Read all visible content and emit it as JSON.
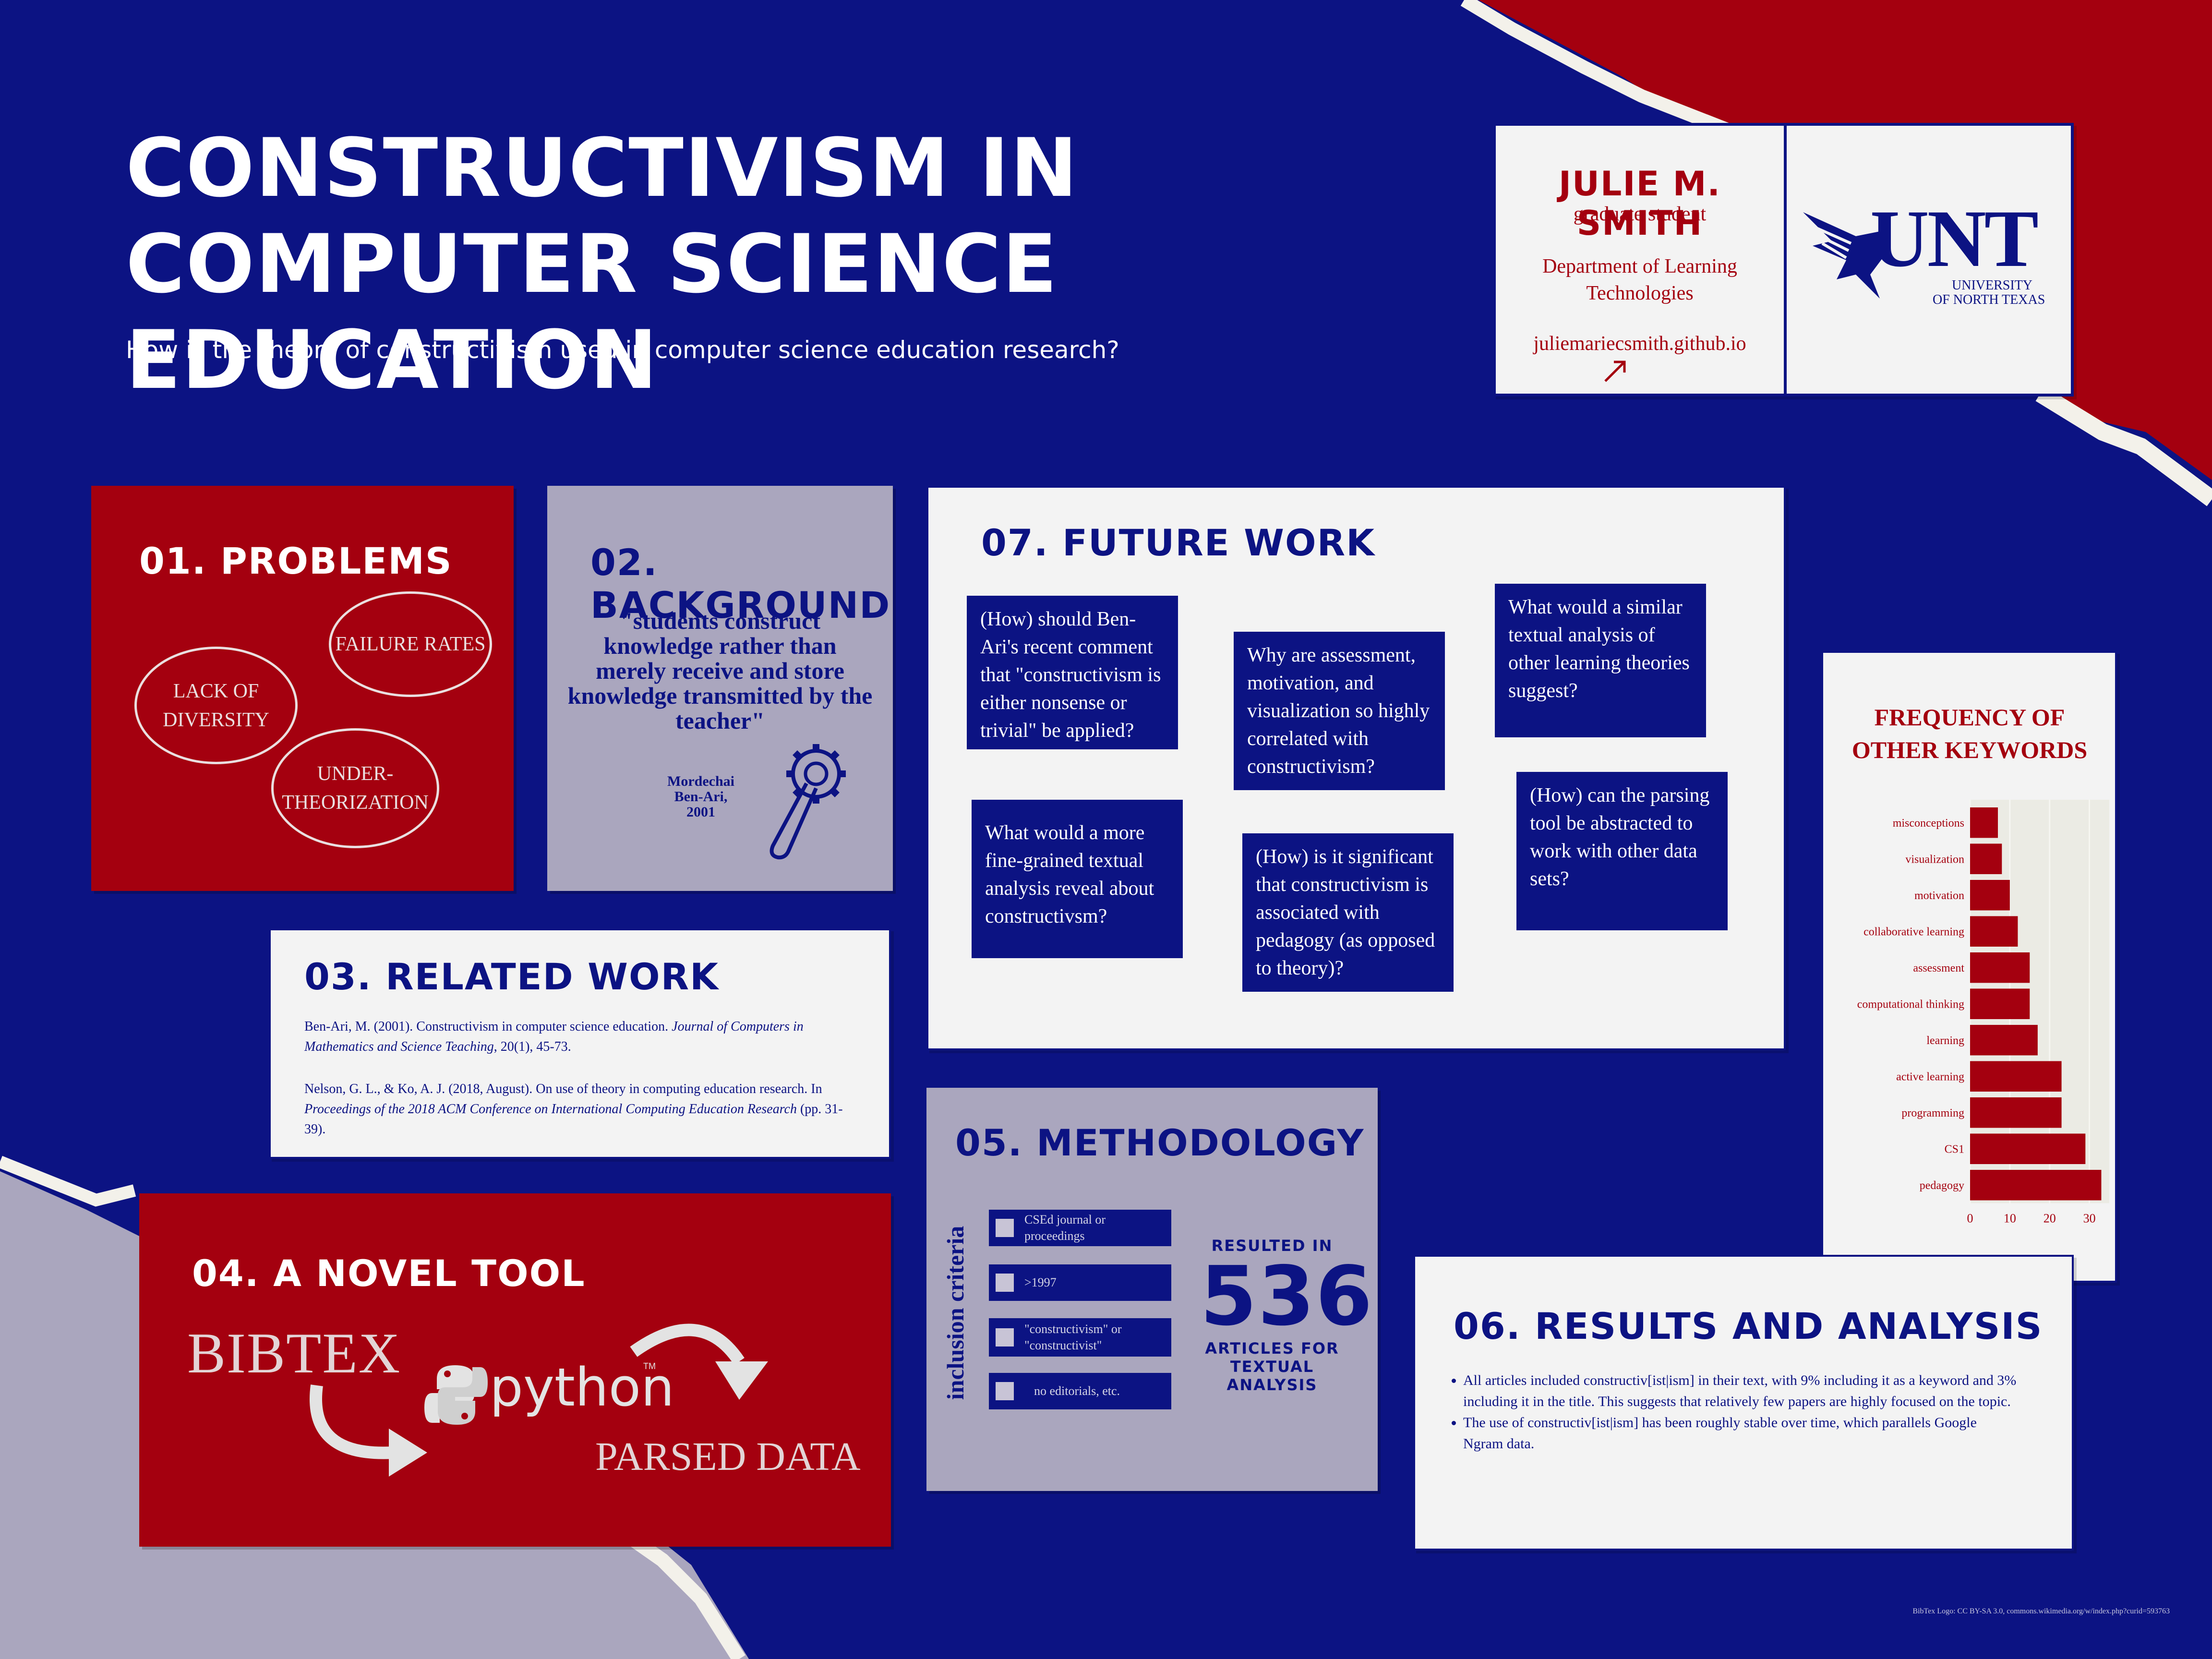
{
  "header": {
    "title_line1": "CONSTRUCTIVISM IN",
    "title_line2": "COMPUTER SCIENCE EDUCATION",
    "question": "How is the theory of constructivism used in computer science education research?"
  },
  "author": {
    "name": "JULIE M. SMITH",
    "role": "graduate student",
    "department_line1": "Department of Learning",
    "department_line2": "Technologies",
    "website": "juliemariecsmith.github.io",
    "logo_text": "UNT",
    "logo_sub1": "UNIVERSITY",
    "logo_sub2": "OF NORTH TEXAS"
  },
  "problems": {
    "heading": "01. PROBLEMS",
    "items": [
      "FAILURE RATES",
      "LACK OF DIVERSITY",
      "UNDER-THEORIZATION"
    ]
  },
  "background": {
    "heading": "02. BACKGROUND",
    "quote": "\"students construct knowledge rather than merely receive and store knowledge transmitted by the teacher\"",
    "attribution_line1": "Mordechai",
    "attribution_line2": "Ben-Ari,",
    "attribution_line3": "2001"
  },
  "related_work": {
    "heading": "03. RELATED WORK",
    "ref1_plain": "Ben-Ari, M. (2001). Constructivism in computer science education. ",
    "ref1_italic": "Journal of Computers in Mathematics and Science Teaching",
    "ref1_tail": ", 20(1), 45-73.",
    "ref2_plain": "Nelson, G. L., & Ko, A. J. (2018, August). On use of theory in computing education research. In ",
    "ref2_italic": "Proceedings of the 2018 ACM Conference on International Computing Education Research",
    "ref2_tail": " (pp. 31-39)."
  },
  "novel_tool": {
    "heading": "04. A NOVEL TOOL",
    "bibtex_label": "BIBTEX",
    "python_label": "python",
    "tm": "TM",
    "parsed_label": "PARSED DATA"
  },
  "methodology": {
    "heading": "05. METHODOLOGY",
    "side_label": "inclusion criteria",
    "criteria": [
      "CSEd journal or proceedings",
      ">1997",
      "\"constructivism\" or \"constructivist\"",
      "no editorials, etc."
    ],
    "resulted_in": "RESULTED IN",
    "count": "536",
    "articles_for": "ARTICLES FOR",
    "textual_analysis": "TEXTUAL ANALYSIS"
  },
  "results": {
    "heading": "06. RESULTS AND ANALYSIS",
    "bullets": [
      "All articles included constructiv[ist|ism] in their text, with 9% including it as a keyword and 3% including it in the title. This suggests that relatively few papers are highly focused on the topic.",
      "The use of constructiv[ist|ism] has been roughly stable over time, which parallels Google Ngram data."
    ]
  },
  "future_work": {
    "heading": "07. FUTURE WORK",
    "questions": [
      "(How) should Ben-Ari's recent comment that \"constructivism is either nonsense or trivial\" be applied?",
      "Why are assessment, motivation, and visualization so highly correlated with constructivism?",
      "What would a similar textual analysis of other learning theories suggest?",
      "What would a more fine-grained textual analysis reveal about constructivsm?",
      "(How) is it significant that constructivism is associated with pedagogy (as opposed to theory)?",
      "(How) can the parsing tool be abstracted to work with other data sets?"
    ]
  },
  "footer": {
    "credit": "BibTex Logo: CC BY-SA 3.0, commons.wikimedia.org/w/index.php?curid=593763"
  },
  "colors": {
    "navy": "#0c1383",
    "red": "#a4000f",
    "lavender": "#aaa6be",
    "offwhite": "#f3f3f3"
  },
  "chart_data": {
    "type": "bar",
    "orientation": "horizontal",
    "title": "FREQUENCY OF OTHER KEYWORDS",
    "categories": [
      "misconceptions",
      "visualization",
      "motivation",
      "collaborative learning",
      "assessment",
      "computational thinking",
      "learning",
      "active learning",
      "programming",
      "CS1",
      "pedagogy"
    ],
    "values": [
      7,
      8,
      10,
      12,
      15,
      15,
      17,
      23,
      23,
      29,
      33
    ],
    "xticks": [
      "0",
      "10",
      "20",
      "30"
    ],
    "xlim": [
      0,
      35
    ]
  }
}
